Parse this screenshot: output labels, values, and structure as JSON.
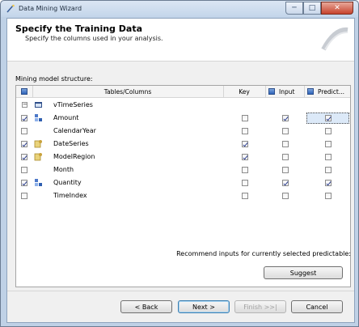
{
  "window": {
    "title": "Data Mining Wizard"
  },
  "header": {
    "title": "Specify the Training Data",
    "subtitle": "Specify the columns used in your analysis."
  },
  "structure_label": "Mining model structure:",
  "grid": {
    "headers": {
      "tables_columns": "Tables/Columns",
      "key": "Key",
      "input": "Input",
      "predict": "Predict..."
    },
    "table_name": "vTimeSeries",
    "rows": [
      {
        "name": "Amount",
        "selected": true,
        "key": false,
        "input": true,
        "predict": true,
        "icon": "numeric-column-icon"
      },
      {
        "name": "CalendarYear",
        "selected": false,
        "key": false,
        "input": false,
        "predict": false,
        "icon": "none"
      },
      {
        "name": "DateSeries",
        "selected": true,
        "key": true,
        "input": false,
        "predict": false,
        "icon": "key-column-icon"
      },
      {
        "name": "ModelRegion",
        "selected": true,
        "key": true,
        "input": false,
        "predict": false,
        "icon": "key-column-icon"
      },
      {
        "name": "Month",
        "selected": false,
        "key": false,
        "input": false,
        "predict": false,
        "icon": "none"
      },
      {
        "name": "Quantity",
        "selected": true,
        "key": false,
        "input": true,
        "predict": true,
        "icon": "numeric-column-icon"
      },
      {
        "name": "TimeIndex",
        "selected": false,
        "key": false,
        "input": false,
        "predict": false,
        "icon": "none"
      }
    ]
  },
  "recommend_text": "Recommend inputs for currently selected predictable:",
  "buttons": {
    "suggest": "Suggest",
    "back": "< Back",
    "next": "Next >",
    "finish": "Finish >>|",
    "cancel": "Cancel"
  }
}
